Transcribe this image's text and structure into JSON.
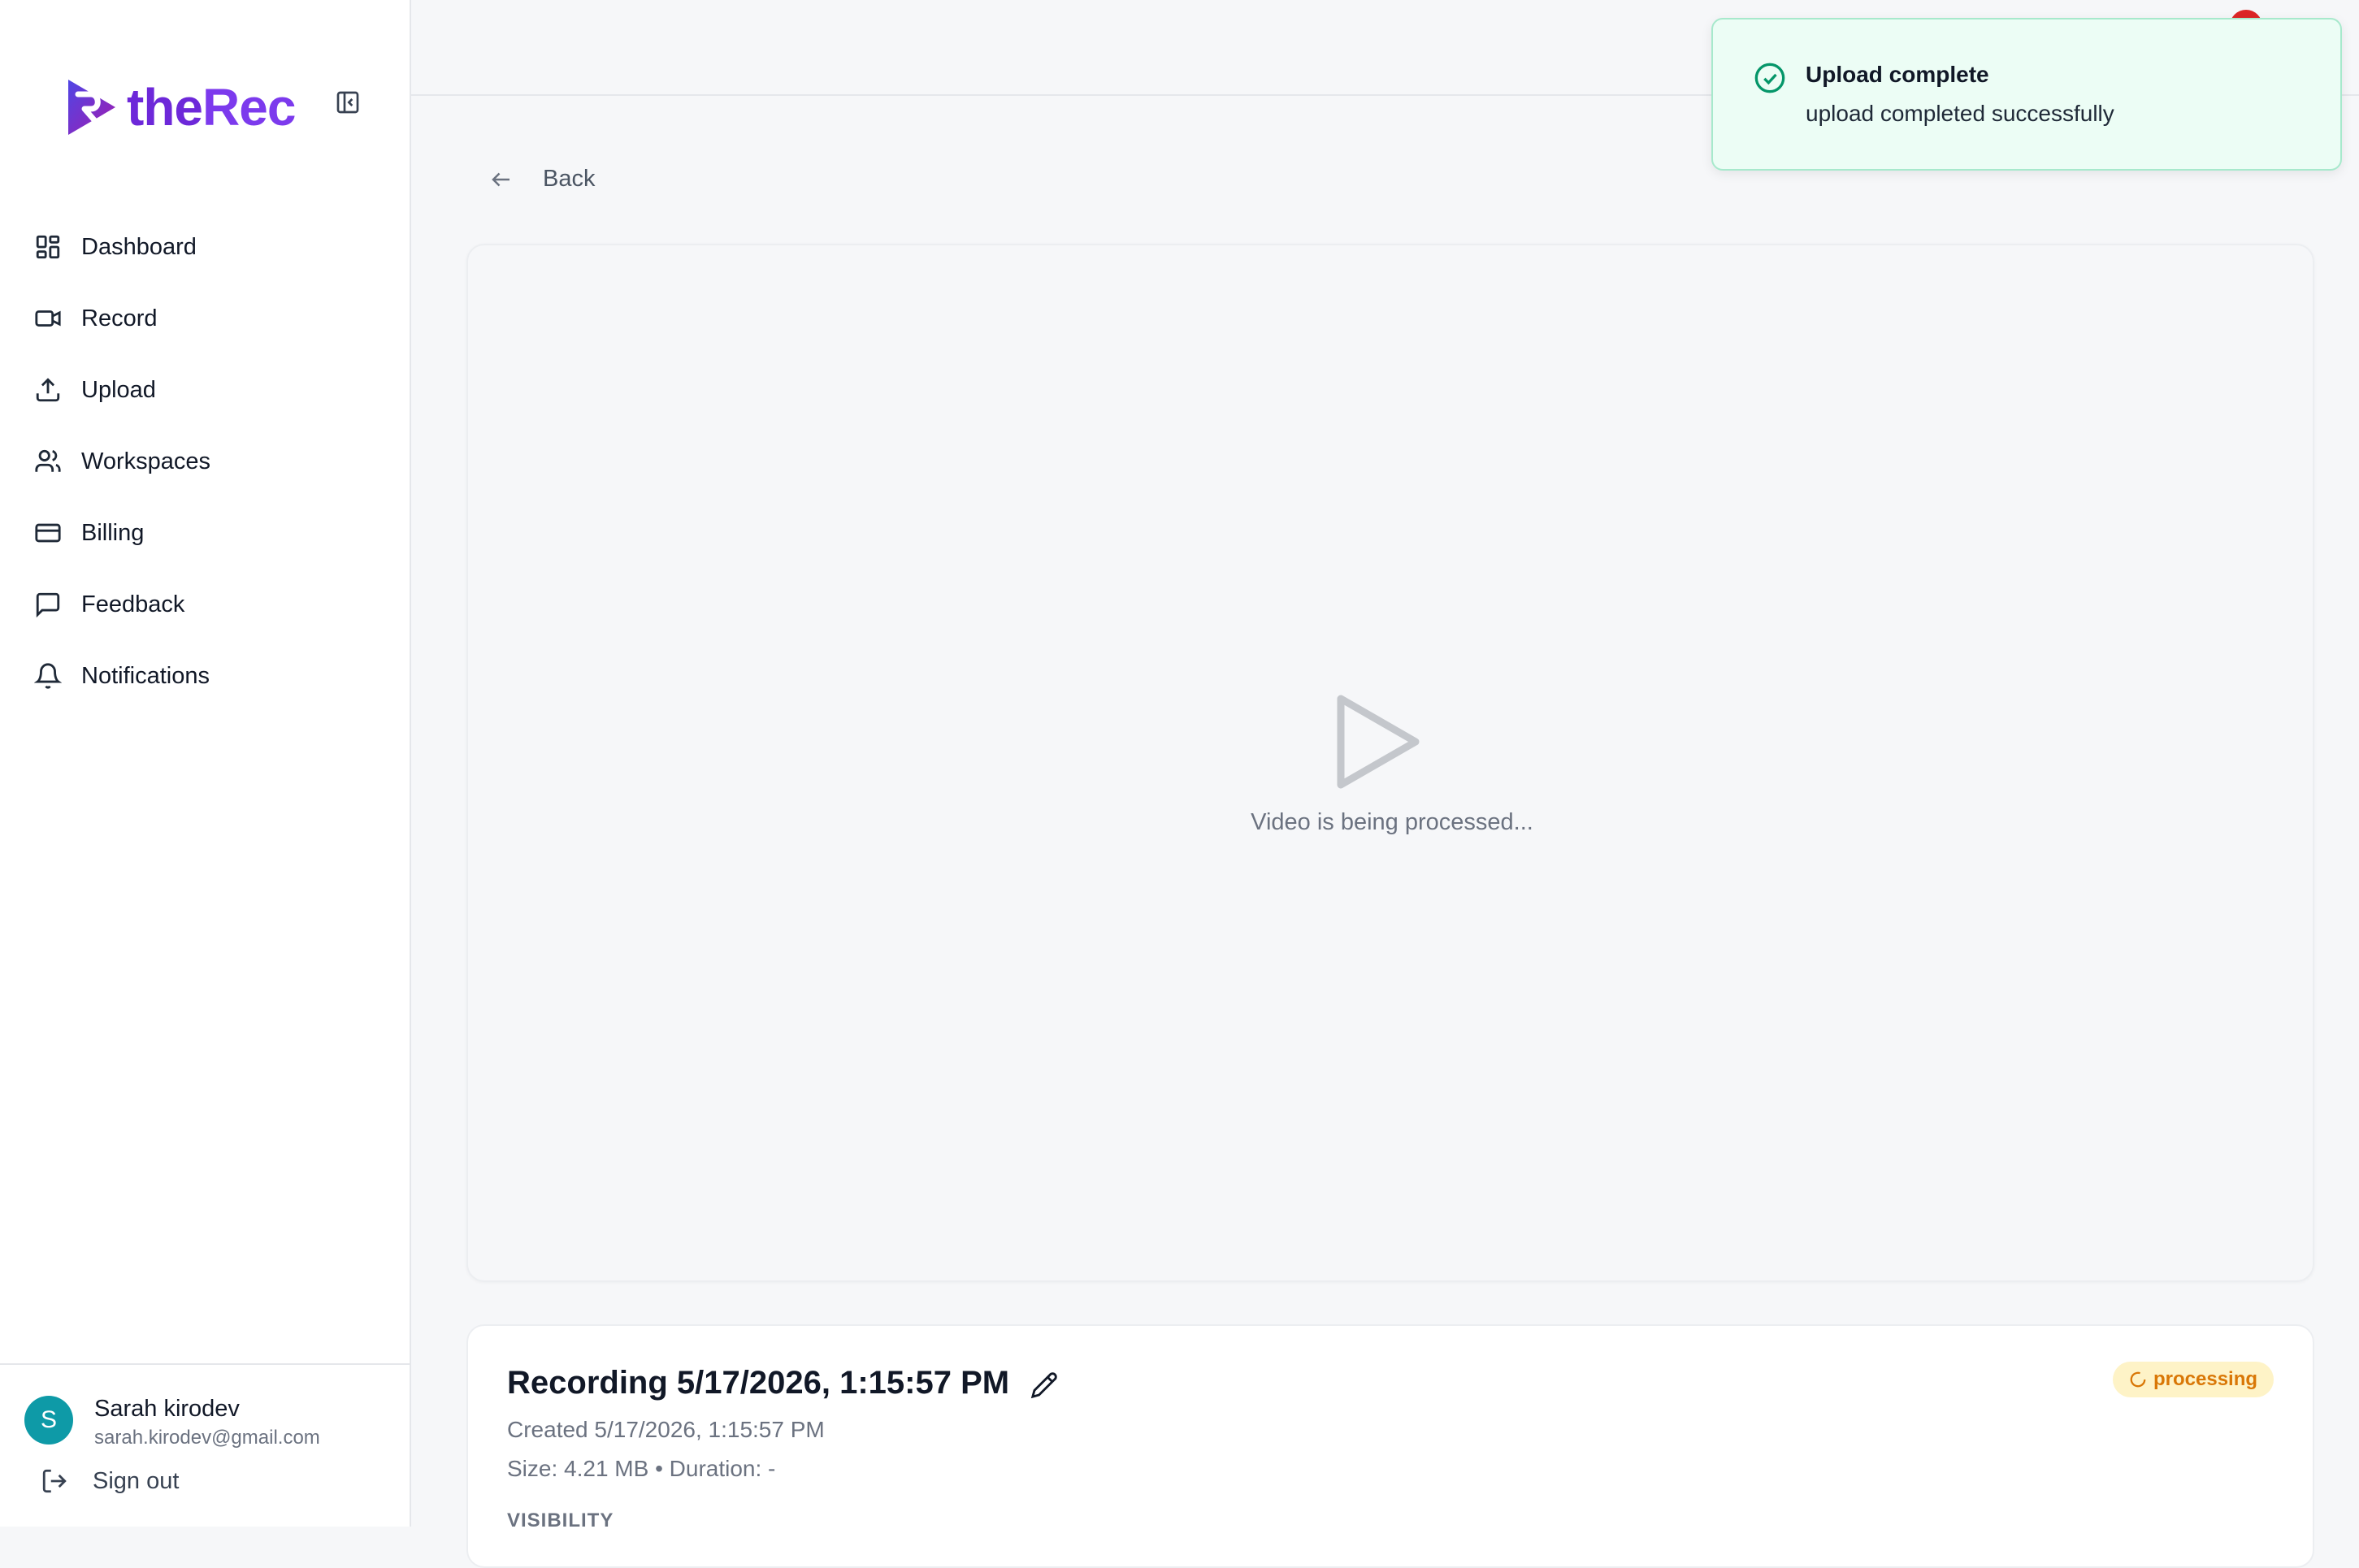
{
  "brand": {
    "name_prefix": "the",
    "name_suffix": "Rec",
    "logo_icon": "therec-logo"
  },
  "sidebar": {
    "collapse_icon": "sidebar-collapse-icon",
    "items": [
      {
        "label": "Dashboard",
        "icon": "grid-icon"
      },
      {
        "label": "Record",
        "icon": "video-camera-icon"
      },
      {
        "label": "Upload",
        "icon": "upload-icon"
      },
      {
        "label": "Workspaces",
        "icon": "users-icon"
      },
      {
        "label": "Billing",
        "icon": "credit-card-icon"
      },
      {
        "label": "Feedback",
        "icon": "message-icon"
      },
      {
        "label": "Notifications",
        "icon": "bell-icon"
      }
    ]
  },
  "user": {
    "initial": "S",
    "name": "Sarah kirodev",
    "email": "sarah.kirodev@gmail.com",
    "signout_label": "Sign out",
    "avatar_color": "#0e9aa7"
  },
  "back": {
    "label": "Back"
  },
  "video": {
    "status_text": "Video is being processed..."
  },
  "recording": {
    "title": "Recording 5/17/2026, 1:15:57 PM",
    "created": "Created 5/17/2026, 1:15:57 PM",
    "size_duration": "Size: 4.21 MB • Duration: -",
    "visibility_label": "VISIBILITY",
    "status": "processing"
  },
  "toast": {
    "title": "Upload complete",
    "message": "upload completed successfully",
    "color": "#059669"
  },
  "colors": {
    "brand": "#7c3aed",
    "processing": "#d97706",
    "success": "#059669",
    "notification_dot": "#dc2626"
  }
}
